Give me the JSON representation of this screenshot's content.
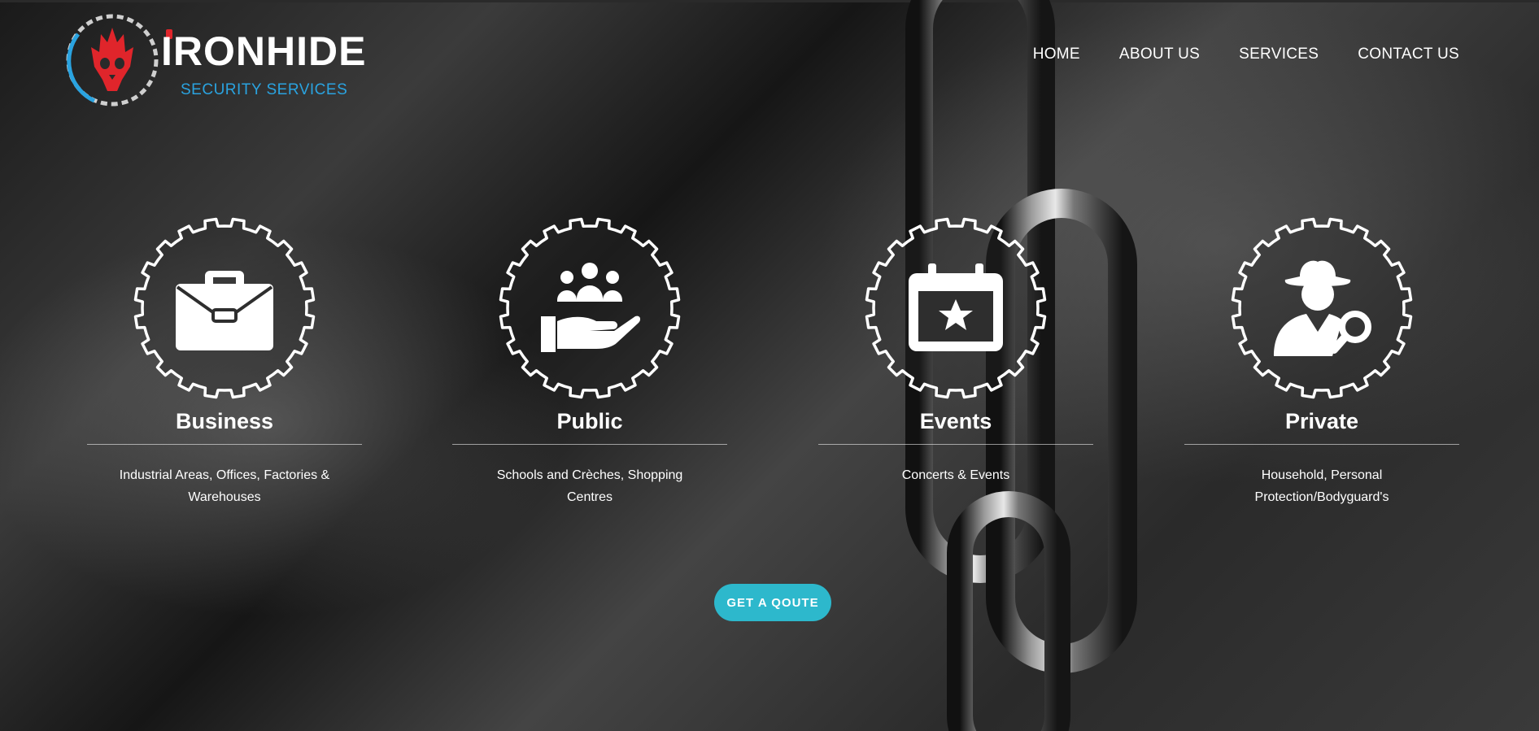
{
  "brand": {
    "name": "IRONHIDE",
    "subtitle": "SECURITY SERVICES",
    "colors": {
      "accent_red": "#e0252b",
      "accent_blue": "#2aa3e0"
    },
    "logo_icon": "skull-gear-icon"
  },
  "nav": {
    "items": [
      {
        "label": "HOME"
      },
      {
        "label": "ABOUT US"
      },
      {
        "label": "SERVICES"
      },
      {
        "label": "CONTACT US"
      }
    ]
  },
  "services": [
    {
      "title": "Business",
      "description": "Industrial Areas, Offices, Factories & Warehouses",
      "icon": "briefcase-icon"
    },
    {
      "title": "Public",
      "description": "Schools and Crèches, Shopping Centres",
      "icon": "people-hand-icon"
    },
    {
      "title": "Events",
      "description": "Concerts & Events",
      "icon": "calendar-star-icon"
    },
    {
      "title": "Private",
      "description": "Household, Personal Protection/Bodyguard's",
      "icon": "detective-icon"
    }
  ],
  "cta": {
    "label": "GET A QOUTE",
    "color": "#2db8cc"
  }
}
